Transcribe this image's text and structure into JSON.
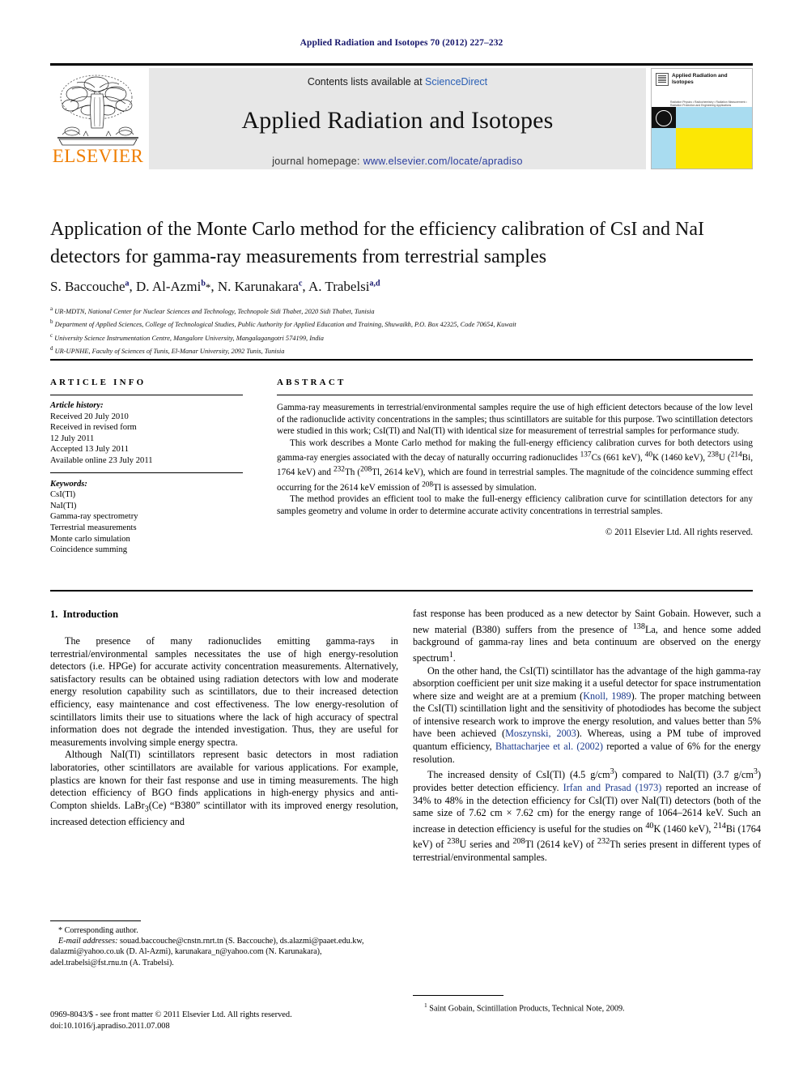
{
  "running_head": "Applied Radiation and Isotopes 70 (2012) 227–232",
  "masthead": {
    "contents_prefix": "Contents lists available at ",
    "contents_link": "ScienceDirect",
    "journal_title": "Applied Radiation and Isotopes",
    "homepage_label": "journal homepage: ",
    "homepage_url": "www.elsevier.com/locate/apradiso",
    "publisher": "ELSEVIER",
    "cover": {
      "title": "Applied Radiation and Isotopes",
      "subtitle": "Radiation Physics • Radiochemistry • Radiation Measurement • Radiation Protection and Engineering Applications"
    }
  },
  "article": {
    "title": "Application of the Monte Carlo method for the efficiency calibration of CsI and NaI detectors for gamma-ray measurements from terrestrial samples",
    "authors": [
      {
        "name": "S. Baccouche",
        "marks": "a",
        "star": false
      },
      {
        "name": "D. Al-Azmi",
        "marks": "b",
        "star": true
      },
      {
        "name": "N. Karunakara",
        "marks": "c",
        "star": false
      },
      {
        "name": "A. Trabelsi",
        "marks": "a,d",
        "star": false
      }
    ],
    "affiliations": [
      {
        "mark": "a",
        "text": "UR-MDTN, National Center for Nuclear Sciences and Technology, Technopole Sidi Thabet, 2020 Sidi Thabet, Tunisia"
      },
      {
        "mark": "b",
        "text": "Department of Applied Sciences, College of Technological Studies, Public Authority for Applied Education and Training, Shuwaikh, P.O. Box 42325, Code 70654, Kuwait"
      },
      {
        "mark": "c",
        "text": "University Science Instrumentation Centre, Mangalore University, Mangalagangotri 574199, India"
      },
      {
        "mark": "d",
        "text": "UR-UPNHE, Faculty of Sciences of Tunis, El-Manar University, 2092 Tunis, Tunisia"
      }
    ]
  },
  "article_info": {
    "heading": "ARTICLE INFO",
    "history_label": "Article history:",
    "history": [
      "Received 20 July 2010",
      "Received in revised form",
      "12 July 2011",
      "Accepted 13 July 2011",
      "Available online 23 July 2011"
    ],
    "keywords_label": "Keywords:",
    "keywords": [
      "CsI(Tl)",
      "NaI(Tl)",
      "Gamma-ray spectrometry",
      "Terrestrial measurements",
      "Monte carlo simulation",
      "Coincidence summing"
    ]
  },
  "abstract": {
    "heading": "ABSTRACT",
    "paragraphs": [
      "Gamma-ray measurements in terrestrial/environmental samples require the use of high efficient detectors because of the low level of the radionuclide activity concentrations in the samples; thus scintillators are suitable for this purpose. Two scintillation detectors were studied in this work; CsI(Tl) and NaI(Tl) with identical size for measurement of terrestrial samples for performance study.",
      "This work describes a Monte Carlo method for making the full-energy efficiency calibration curves for both detectors using gamma-ray energies associated with the decay of naturally occurring radionuclides 137Cs (661 keV), 40K (1460 keV), 238U (214Bi, 1764 keV) and 232Th (208Tl, 2614 keV), which are found in terrestrial samples. The magnitude of the coincidence summing effect occurring for the 2614 keV emission of 208Tl is assessed by simulation.",
      "The method provides an efficient tool to make the full-energy efficiency calibration curve for scintillation detectors for any samples geometry and volume in order to determine accurate activity concentrations in terrestrial samples."
    ],
    "copyright": "© 2011 Elsevier Ltd. All rights reserved."
  },
  "body": {
    "section_number": "1.",
    "section_title": "Introduction",
    "left_paragraphs": [
      "The presence of many radionuclides emitting gamma-rays in terrestrial/environmental samples necessitates the use of high energy-resolution detectors (i.e. HPGe) for accurate activity concentration measurements. Alternatively, satisfactory results can be obtained using radiation detectors with low and moderate energy resolution capability such as scintillators, due to their increased detection efficiency, easy maintenance and cost effectiveness. The low energy-resolution of scintillators limits their use to situations where the lack of high accuracy of spectral information does not degrade the intended investigation. Thus, they are useful for measurements involving simple energy spectra.",
      "Although NaI(Tl) scintillators represent basic detectors in most radiation laboratories, other scintillators are available for various applications. For example, plastics are known for their fast response and use in timing measurements. The high detection efficiency of BGO finds applications in high-energy physics and anti-Compton shields. LaBr3(Ce) “B380” scintillator with its improved energy resolution, increased detection efficiency and"
    ],
    "right_paragraphs": [
      "fast response has been produced as a new detector by Saint Gobain. However, such a new material (B380) suffers from the presence of 138La, and hence some added background of gamma-ray lines and beta continuum are observed on the energy spectrum1.",
      "On the other hand, the CsI(Tl) scintillator has the advantage of the high gamma-ray absorption coefficient per unit size making it a useful detector for space instrumentation where size and weight are at a premium (Knoll, 1989). The proper matching between the CsI(Tl) scintillation light and the sensitivity of photodiodes has become the subject of intensive research work to improve the energy resolution, and values better than 5% have been achieved (Moszynski, 2003). Whereas, using a PM tube of improved quantum efficiency, Bhattacharjee et al. (2002) reported a value of 6% for the energy resolution.",
      "The increased density of CsI(Tl) (4.5 g/cm3) compared to NaI(Tl) (3.7 g/cm3) provides better detection efficiency. Irfan and Prasad (1973) reported an increase of 34% to 48% in the detection efficiency for CsI(Tl) over NaI(Tl) detectors (both of the same size of 7.62 cm × 7.62 cm) for the energy range of 1064–2614 keV. Such an increase in detection efficiency is useful for the studies on 40K (1460 keV), 214Bi (1764 keV) of 238U series and 208Tl (2614 keV) of 232Th series present in different types of terrestrial/environmental samples."
    ],
    "citations": [
      "Knoll, 1989",
      "Moszynski, 2003",
      "Bhattacharjee et al. (2002)",
      "Irfan and Prasad (1973)"
    ]
  },
  "footnotes": {
    "corresponding": "* Corresponding author.",
    "email_label": "E-mail addresses:",
    "emails": "souad.baccouche@cnstn.rnrt.tn (S. Baccouche), ds.alazmi@paaet.edu.kw, dalazmi@yahoo.co.uk (D. Al-Azmi), karunakara_n@yahoo.com (N. Karunakara), adel.trabelsi@fst.rnu.tn (A. Trabelsi).",
    "right_mark": "1",
    "right_note": "Saint Gobain, Scintillation Products, Technical Note, 2009."
  },
  "issn": {
    "line1": "0969-8043/$ - see front matter © 2011 Elsevier Ltd. All rights reserved.",
    "line2": "doi:10.1016/j.apradiso.2011.07.008"
  },
  "colors": {
    "running_head": "#15156b",
    "link": "#2a5fb5",
    "citation": "#1b3a8c",
    "elsevier_orange": "#ef7d00",
    "masthead_bg": "#e7e7e7",
    "cover_yellow": "#fce705",
    "cover_blue": "#a9dcf0"
  }
}
